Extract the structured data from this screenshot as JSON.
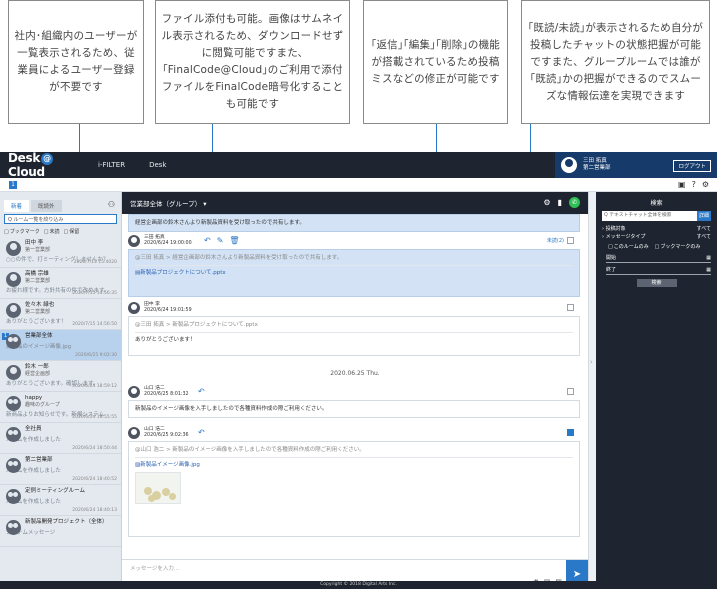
{
  "callouts": [
    {
      "text": "社内･組織内のユーザーが一覧表示されるため、従業員によるユーザー登録が不要です"
    },
    {
      "text": "ファイル添付も可能。画像はサムネイル表示されるため、ダウンロードせずに閲覧可能ですまた､｢FinalCode@Cloud｣のご利用で添付ファイルをFinalCode暗号化することも可能です"
    },
    {
      "text": "｢返信｣｢編集｣｢削除｣の機能が搭載されているため投稿ミスなどの修正が可能です"
    },
    {
      "text": "｢既読/未読｣が表示されるため自分が投稿したチャットの状態把握が可能ですまた、グループルームでは誰が｢既読｣かの把握ができるのでスムーズな情報伝達を実現できます"
    }
  ],
  "topbar": {
    "logo_left": "Desk",
    "logo_at": "@",
    "logo_right": "Cloud",
    "nav": [
      "i-FILTER",
      "Desk"
    ],
    "user_name": "三田 拓真",
    "user_dept": "第二営業部",
    "logout": "ログアウト"
  },
  "toolbar": {
    "badge": "1",
    "icons": [
      "bookmark-icon",
      "help-icon",
      "settings-icon"
    ]
  },
  "sidebar": {
    "tabs": [
      "新着",
      "既読外"
    ],
    "search_placeholder": "Q ルーム一覧を絞り込み",
    "filters": [
      "ブックマーク",
      "未読",
      "保留"
    ],
    "rooms": [
      {
        "name": "田中 李",
        "sub": "第一営業部",
        "preview": "○○の件で、打ミーティングしませんか？",
        "time": "2020/7/15 15:4020",
        "group": false,
        "selected": false,
        "badge": ""
      },
      {
        "name": "高橋 宗雄",
        "sub": "第二営業部",
        "preview": "お疲れ様です。方針共有の件で改めます。",
        "time": "2020/7/15 14:56:35",
        "group": false,
        "selected": false,
        "badge": ""
      },
      {
        "name": "佐々木 緑也",
        "sub": "第二営業部",
        "preview": "ありがとうございます！",
        "time": "2020/7/15 14:56:50",
        "group": false,
        "selected": false,
        "badge": ""
      },
      {
        "name": "営業部全体",
        "sub": "",
        "preview": "新製品のイメージ画像.jpg",
        "time": "2020/6/25 9:02:30",
        "group": true,
        "selected": true,
        "badge": "1"
      },
      {
        "name": "鈴木 一郎",
        "sub": "経営企画部",
        "preview": "ありがとうございます。確認します。",
        "time": "2020/6/24 18:59:12",
        "group": false,
        "selected": false,
        "badge": ""
      },
      {
        "name": "happy",
        "sub": "趣味のグループ",
        "preview": "新商品よりお知らせです。新規システム",
        "time": "2020/6/24 18:55:55",
        "group": true,
        "selected": false,
        "badge": ""
      },
      {
        "name": "全社員",
        "sub": "",
        "preview": "ルームを作成しました",
        "time": "2020/6/24 18:50:44",
        "group": true,
        "selected": false,
        "badge": ""
      },
      {
        "name": "第二営業部",
        "sub": "",
        "preview": "ルームを作成しました",
        "time": "2020/6/24 18:40:52",
        "group": true,
        "selected": false,
        "badge": ""
      },
      {
        "name": "定例ミーティングルーム",
        "sub": "",
        "preview": "ルームを作成しました",
        "time": "2020/6/24 18:40:13",
        "group": true,
        "selected": false,
        "badge": ""
      },
      {
        "name": "新製品開発プロジェクト（全体）",
        "sub": "",
        "preview": "システムメッセージ",
        "time": "",
        "group": true,
        "selected": false,
        "badge": ""
      }
    ]
  },
  "chat": {
    "title": "営業部全体（グループ）",
    "title_arrow": "▾",
    "date_sep": "2020.06.25 Thu.",
    "messages": [
      {
        "who1": "",
        "who2": "",
        "quote": "",
        "body": "経営企画部の鈴木さんより新製品資料を受け取ったので共有します。",
        "link": "",
        "blue": true
      },
      {
        "who1": "三田 拓真",
        "who2": "2020/6/24 19:00:00",
        "quote": "@三田 拓真 > 経営企画部の鈴木さんより新製品資料を受け取ったので共有します。",
        "body": "",
        "link": "新製品プロジェクトについて.pptx",
        "blue": true,
        "read": "未読(2)"
      },
      {
        "who1": "田中 李",
        "who2": "2020/6/24 19:01:59",
        "quote": "@三田 拓真 > 新製品プロジェクトについて.pptx",
        "body": "ありがとうございます！",
        "link": "",
        "blue": false
      },
      {
        "who1": "山口 浩二",
        "who2": "2020/6/25 8:01:32",
        "quote": "",
        "body": "新製品のイメージ画像を入手しましたので各種資料作成の際ご利用ください。",
        "link": "",
        "blue": false
      },
      {
        "who1": "山口 浩二",
        "who2": "2020/6/25 9:02:36",
        "quote": "@山口 浩二 > 新製品のイメージ画像を入手しましたので各種資料作成の際ご利用ください。",
        "body": "",
        "link": "新製品イメージ画像.jpg",
        "blue": false
      }
    ],
    "input_placeholder": "メッセージを入力...",
    "input_icons": [
      "#",
      "▤",
      "▨"
    ],
    "send_icon": "➤"
  },
  "right_panel": {
    "title": "検索",
    "search_placeholder": "Q テキストチャット全体を検索",
    "search_btn": "詳細",
    "rows": [
      {
        "label": "› 投稿対象",
        "value": "すべて"
      },
      {
        "label": "› メッセージタイプ",
        "value": "すべて"
      }
    ],
    "opts": [
      "このルームのみ",
      "ブックマークのみ"
    ],
    "dates": [
      {
        "label": "開始"
      },
      {
        "label": "終了"
      }
    ],
    "exec": "検索"
  },
  "footer": {
    "text": "Copyright © 2018 Digital Arts Inc."
  },
  "colors": {
    "accent": "#2a78c8",
    "dark": "#1f2530",
    "user_bg": "#163a6a",
    "selected_room": "#b8d1ec"
  }
}
